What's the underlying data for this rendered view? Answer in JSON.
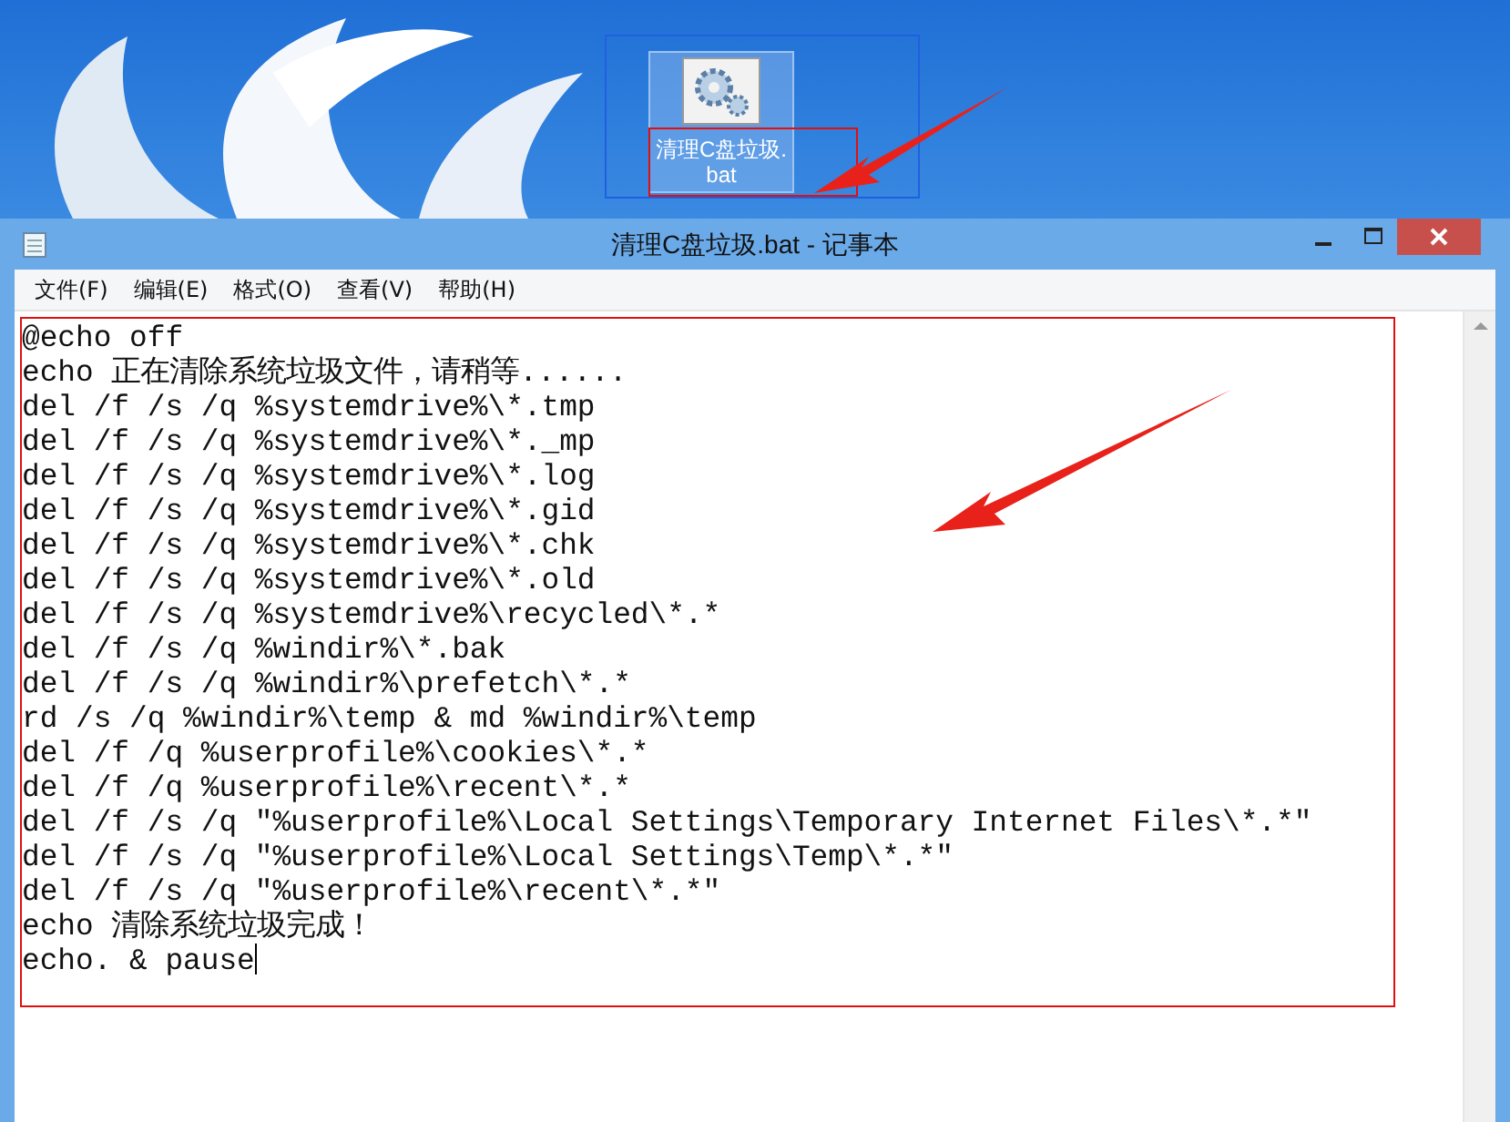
{
  "desktop": {
    "icons": [
      {
        "label_lines": [
          "清理C盘垃圾.",
          "bat"
        ],
        "selected": true
      }
    ]
  },
  "window": {
    "title": "清理C盘垃圾.bat - 记事本",
    "menu": [
      "文件(F)",
      "编辑(E)",
      "格式(O)",
      "查看(V)",
      "帮助(H)"
    ],
    "content": [
      "@echo off",
      "echo 正在清除系统垃圾文件，请稍等......",
      "del /f /s /q %systemdrive%\\*.tmp",
      "del /f /s /q %systemdrive%\\*._mp",
      "del /f /s /q %systemdrive%\\*.log",
      "del /f /s /q %systemdrive%\\*.gid",
      "del /f /s /q %systemdrive%\\*.chk",
      "del /f /s /q %systemdrive%\\*.old",
      "del /f /s /q %systemdrive%\\recycled\\*.*",
      "del /f /s /q %windir%\\*.bak",
      "del /f /s /q %windir%\\prefetch\\*.*",
      "rd /s /q %windir%\\temp & md %windir%\\temp",
      "del /f /q %userprofile%\\cookies\\*.*",
      "del /f /q %userprofile%\\recent\\*.*",
      "del /f /s /q \"%userprofile%\\Local Settings\\Temporary Internet Files\\*.*\"",
      "del /f /s /q \"%userprofile%\\Local Settings\\Temp\\*.*\"",
      "del /f /s /q \"%userprofile%\\recent\\*.*\"",
      "echo 清除系统垃圾完成！",
      "echo. & pause"
    ]
  }
}
